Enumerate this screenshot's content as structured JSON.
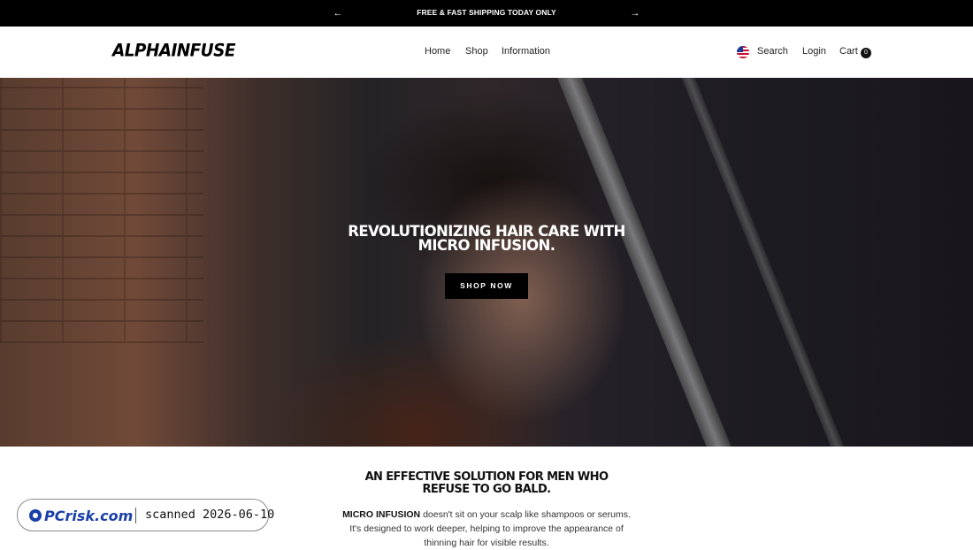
{
  "announcement": {
    "prev_icon": "arrow-left-icon",
    "next_icon": "arrow-right-icon",
    "prev_glyph": "←",
    "next_glyph": "→",
    "message": "FREE & FAST SHIPPING TODAY ONLY"
  },
  "header": {
    "logo_text": "ALPHAINFUSE",
    "nav": {
      "home": "Home",
      "shop": "Shop",
      "information": "Information"
    },
    "flag_icon": "us-flag-icon",
    "search_label": "Search",
    "login_label": "Login",
    "cart_label": "Cart",
    "cart_count": "0"
  },
  "hero": {
    "title": "REVOLUTIONIZING HAIR CARE WITH MICRO INFUSION.",
    "cta_label": "SHOP NOW"
  },
  "intro": {
    "title": "AN EFFECTIVE SOLUTION FOR MEN WHO REFUSE TO GO BALD.",
    "body_bold": "MICRO INFUSION",
    "body_rest": " doesn't sit on your scalp like shampoos or serums. It's designed to work deeper, helping to improve the appearance of thinning hair for visible results."
  },
  "watermark": {
    "logo_text": "PCrisk.com",
    "text": "scanned 2026-06-10"
  },
  "colors": {
    "announcement_bg": "#000000",
    "button_bg": "#000000",
    "page_bg": "#ffffff",
    "watermark_logo": "#1a3fa8"
  }
}
